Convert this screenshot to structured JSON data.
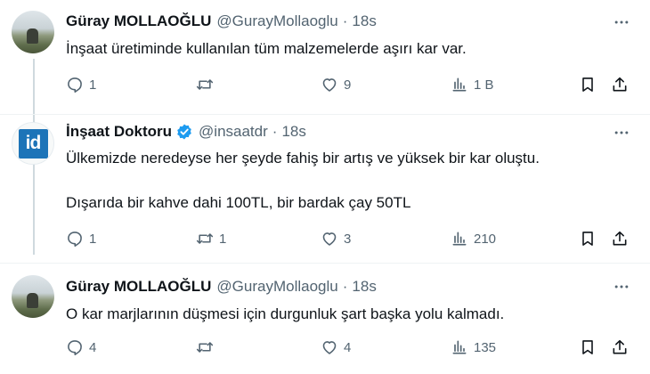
{
  "tweets": [
    {
      "name": "Güray MOLLAOĞLU",
      "handle": "@GurayMollaoglu",
      "dot": "·",
      "time": "18s",
      "avatar_icon": "profile-photo",
      "verified": false,
      "lines": [
        "İnşaat üretiminde kullanılan tüm malzemelerde aşırı kar var."
      ],
      "replies": "1",
      "retweets": "",
      "likes": "9",
      "views": "1 B"
    },
    {
      "name": "İnşaat Doktoru",
      "handle": "@insaatdr",
      "dot": "·",
      "time": "18s",
      "avatar_text": "id",
      "verified": true,
      "lines": [
        "Ülkemizde neredeyse her şeyde fahiş bir artış ve yüksek bir kar oluştu.",
        "Dışarıda bir kahve dahi 100TL, bir bardak çay 50TL"
      ],
      "replies": "1",
      "retweets": "1",
      "likes": "3",
      "views": "210"
    },
    {
      "name": "Güray MOLLAOĞLU",
      "handle": "@GurayMollaoglu",
      "dot": "·",
      "time": "18s",
      "avatar_icon": "profile-photo",
      "verified": false,
      "lines": [
        "O kar marjlarının düşmesi için durgunluk şart başka yolu kalmadı."
      ],
      "replies": "4",
      "retweets": "",
      "likes": "4",
      "views": "135"
    }
  ],
  "colors": {
    "text": "#0f1419",
    "secondary": "#536471",
    "verified_blue": "#1d9bf0",
    "divider": "#eff3f4",
    "logo_blue": "#1d74b8"
  },
  "icons": [
    "more-icon",
    "reply-icon",
    "retweet-icon",
    "like-icon",
    "views-icon",
    "bookmark-icon",
    "share-icon",
    "verified-badge-icon"
  ]
}
